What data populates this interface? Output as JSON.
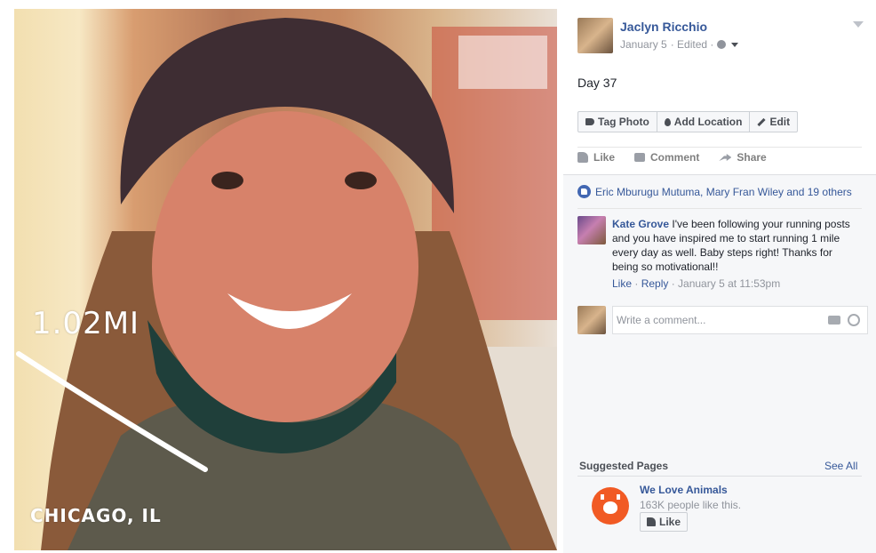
{
  "photo": {
    "overlay_distance": "1.02MI",
    "overlay_city": "CHICAGO, IL"
  },
  "post": {
    "author": "Jaclyn Ricchio",
    "date": "January 5",
    "edited": "· Edited ·",
    "text": "Day 37",
    "actions": {
      "tag_photo": "Tag Photo",
      "add_location": "Add Location",
      "edit": "Edit"
    },
    "ufi": {
      "like": "Like",
      "comment": "Comment",
      "share": "Share"
    },
    "likers": "Eric Mburugu Mutuma, Mary Fran Wiley and 19 others"
  },
  "comment": {
    "author": "Kate Grove",
    "text": "I've been following your running posts and you have inspired me to start running 1 mile every day as well. Baby steps right! Thanks for being so motivational!!",
    "like": "Like",
    "sep1": " · ",
    "reply": "Reply",
    "time": " · January 5 at 11:53pm"
  },
  "composer": {
    "placeholder": "Write a comment..."
  },
  "suggested": {
    "title": "Suggested Pages",
    "see_all": "See All",
    "page_name": "We Love Animals",
    "page_likes": "163K people like this.",
    "like_button": "Like"
  },
  "colors": {
    "link": "#365899",
    "brand": "#4267b2",
    "page_logo": "#f15a24"
  }
}
